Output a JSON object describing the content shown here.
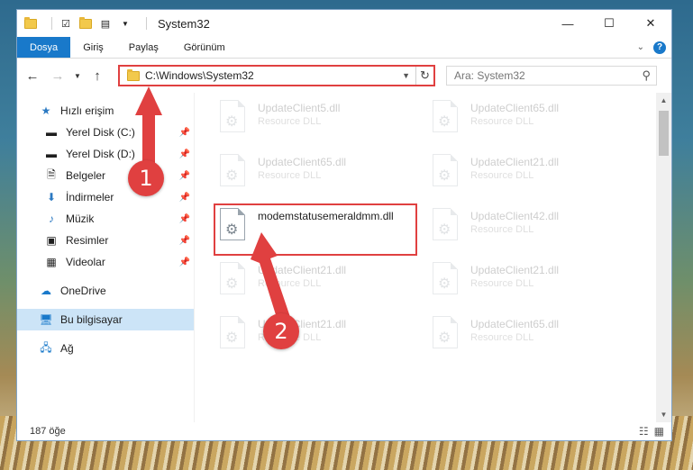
{
  "window": {
    "title": "System32",
    "controls": {
      "minimize": "—",
      "maximize": "☐",
      "close": "✕"
    }
  },
  "ribbon": {
    "tabs": [
      "Dosya",
      "Giriş",
      "Paylaş",
      "Görünüm"
    ]
  },
  "address": {
    "path": "C:\\Windows\\System32",
    "search_placeholder": "Ara: System32"
  },
  "nav": {
    "quick_access": "Hızlı erişim",
    "quick_items": [
      {
        "label": "Yerel Disk (C:)",
        "icon": "drive-icon"
      },
      {
        "label": "Yerel Disk (D:)",
        "icon": "drive-icon"
      },
      {
        "label": "Belgeler",
        "icon": "document-icon"
      },
      {
        "label": "İndirmeler",
        "icon": "download-icon"
      },
      {
        "label": "Müzik",
        "icon": "music-icon"
      },
      {
        "label": "Resimler",
        "icon": "pictures-icon"
      },
      {
        "label": "Videolar",
        "icon": "video-icon"
      }
    ],
    "onedrive": "OneDrive",
    "this_pc": "Bu bilgisayar",
    "network": "Ağ"
  },
  "files": [
    {
      "name": "UpdateClient5.dll",
      "desc": "Resource DLL"
    },
    {
      "name": "UpdateClient65.dll",
      "desc": "Resource DLL"
    },
    {
      "name": "UpdateClient65.dll",
      "desc": "Resource DLL"
    },
    {
      "name": "UpdateClient21.dll",
      "desc": "Resource DLL"
    },
    {
      "name": "modemstatusemeraldmm.dll",
      "desc": ""
    },
    {
      "name": "UpdateClient42.dll",
      "desc": "Resource DLL"
    },
    {
      "name": "UpdateClient21.dll",
      "desc": "Resource DLL"
    },
    {
      "name": "UpdateClient21.dll",
      "desc": "Resource DLL"
    },
    {
      "name": "UpdateClient21.dll",
      "desc": "Resource DLL"
    },
    {
      "name": "UpdateClient65.dll",
      "desc": "Resource DLL"
    }
  ],
  "status": {
    "count": "187 öğe"
  },
  "annotations": {
    "step1": "1",
    "step2": "2",
    "color": "#e04040"
  }
}
